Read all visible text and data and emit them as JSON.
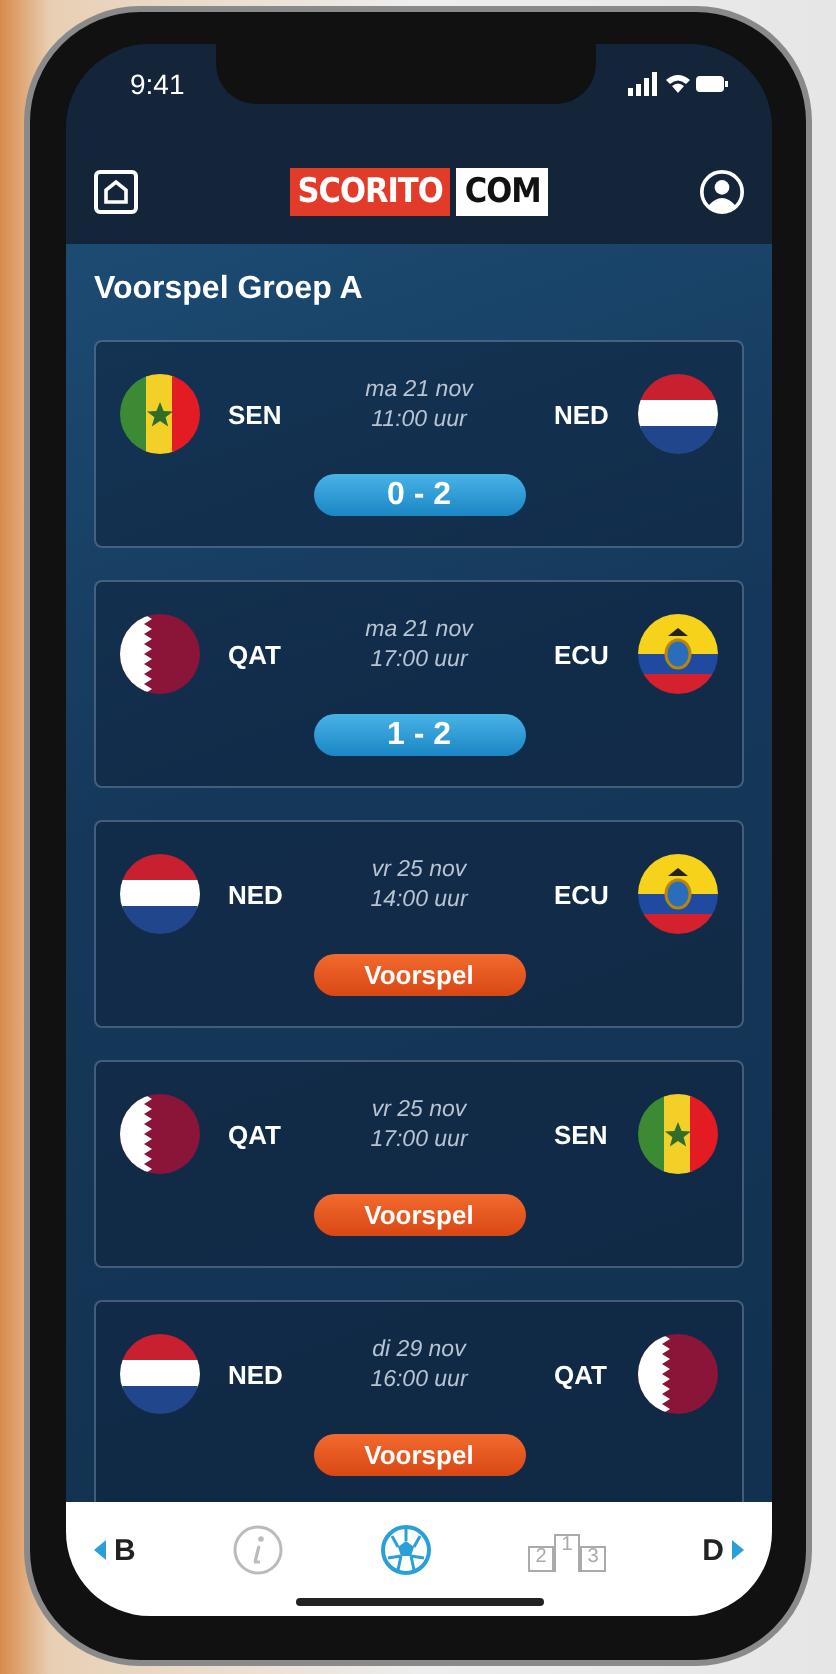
{
  "status_bar": {
    "time": "9:41"
  },
  "header": {
    "logo": [
      "SCORITO",
      "COM"
    ]
  },
  "title": "Voorspel Groep A",
  "matches": [
    {
      "date": "ma 21 nov",
      "time": "11:00 uur",
      "home": {
        "code": "SEN",
        "kind": "senegal"
      },
      "away": {
        "code": "NED",
        "kind": "netherlands"
      },
      "result": {
        "kind": "score",
        "text": "0 - 2"
      }
    },
    {
      "date": "ma 21 nov",
      "time": "17:00 uur",
      "home": {
        "code": "QAT",
        "kind": "qatar"
      },
      "away": {
        "code": "ECU",
        "kind": "ecuador"
      },
      "result": {
        "kind": "score",
        "text": "1 - 2"
      }
    },
    {
      "date": "vr 25 nov",
      "time": "14:00 uur",
      "home": {
        "code": "NED",
        "kind": "netherlands"
      },
      "away": {
        "code": "ECU",
        "kind": "ecuador"
      },
      "result": {
        "kind": "predict",
        "text": "Voorspel"
      }
    },
    {
      "date": "vr 25 nov",
      "time": "17:00 uur",
      "home": {
        "code": "QAT",
        "kind": "qatar"
      },
      "away": {
        "code": "SEN",
        "kind": "senegal"
      },
      "result": {
        "kind": "predict",
        "text": "Voorspel"
      }
    },
    {
      "date": "di 29 nov",
      "time": "16:00 uur",
      "home": {
        "code": "NED",
        "kind": "netherlands"
      },
      "away": {
        "code": "QAT",
        "kind": "qatar"
      },
      "result": {
        "kind": "predict",
        "text": "Voorspel"
      }
    }
  ],
  "bottom_nav": {
    "prev": "B",
    "next": "D",
    "tabs": [
      {
        "kind": "info",
        "selected": false
      },
      {
        "kind": "matches",
        "selected": true
      },
      {
        "kind": "standings",
        "selected": false,
        "digits": [
          "2",
          "1",
          "3"
        ]
      }
    ]
  }
}
